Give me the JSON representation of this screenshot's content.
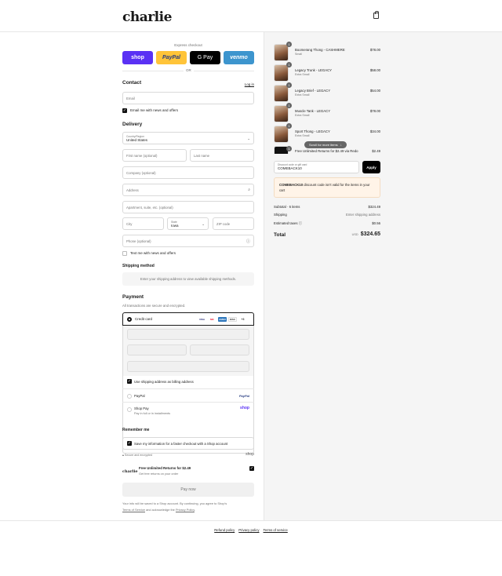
{
  "header": {
    "logo": "charlie"
  },
  "express": {
    "label": "Express checkout",
    "buttons": {
      "shop_pay": "shop",
      "paypal": "PayPal",
      "gpay": "G Pay",
      "venmo": "venmo"
    },
    "or": "OR"
  },
  "contact": {
    "title": "Contact",
    "login": "Log in",
    "email_placeholder": "Email",
    "email_news": "Email me with news and offers"
  },
  "delivery": {
    "title": "Delivery",
    "country_label": "Country/Region",
    "country_value": "United States",
    "first_name": "First name (optional)",
    "last_name": "Last name",
    "company": "Company (optional)",
    "address": "Address",
    "apartment": "Apartment, suite, etc. (optional)",
    "city": "City",
    "state_label": "State",
    "state_value": "Iowa",
    "zip": "ZIP code",
    "phone": "Phone (optional)",
    "text_news": "Text me with news and offers"
  },
  "shipping": {
    "title": "Shipping method",
    "notice": "Enter your shipping address to view available shipping methods."
  },
  "payment": {
    "title": "Payment",
    "subtitle": "All transactions are secure and encrypted.",
    "credit_card": "Credit card",
    "card_logos": [
      "VISA",
      "MC",
      "AMEX",
      "DISC"
    ],
    "more_cards": "+3",
    "billing_same": "Use shipping address as billing address",
    "paypal_label": "PayPal",
    "paypal_logo": "PayPal",
    "shop_pay_label": "Shop Pay",
    "shop_pay_sub": "Pay in full or in installments",
    "shop_pay_logo": "shop"
  },
  "remember": {
    "title": "Remember me",
    "save_info": "Save my information for a faster checkout with a Shop account",
    "secure": "Secure and encrypted",
    "shop_logo": "shop"
  },
  "returns_offer": {
    "logo": "charlie",
    "title": "Free Unlimited Returns for $2.49",
    "sub": "Get free returns on your order"
  },
  "pay_now": "Pay now",
  "legal": {
    "text1": "Your info will be saved to a Shop account. By continuing, you agree to Shop's",
    "terms": "Terms of Service",
    "and": "and acknowledge the",
    "privacy": "Privacy Policy",
    "period": "."
  },
  "order": {
    "items": [
      {
        "name": "Boomerang Thong - CASHMERE",
        "variant": "Small",
        "price": "$78.00",
        "qty": "1"
      },
      {
        "name": "Legacy Trunk - LEGACY",
        "variant": "Extra Small",
        "price": "$58.00",
        "qty": "1"
      },
      {
        "name": "Legacy Brief - LEGACY",
        "variant": "Extra Small",
        "price": "$54.00",
        "qty": "1"
      },
      {
        "name": "Muscle Tank - LEGACY",
        "variant": "Extra Small",
        "price": "$78.00",
        "qty": "1"
      },
      {
        "name": "Sport Thong - LEGACY",
        "variant": "Extra Small",
        "price": "$34.00",
        "qty": "1"
      },
      {
        "name": "Free Unlimited Returns for $2.49 via Redo",
        "variant": "",
        "price": "$2.49",
        "qty": "1"
      }
    ],
    "scroll_hint": "Scroll for more items",
    "discount_label": "Discount code or gift card",
    "discount_value": "COMEBACK10",
    "apply": "Apply",
    "error_code": "COMEBACK10",
    "error_text": "discount code isn't valid for the items in your cart",
    "subtotal_label": "Subtotal · 6 items",
    "subtotal_value": "$324.49",
    "shipping_label": "Shipping",
    "shipping_value": "Enter shipping address",
    "taxes_label": "Estimated taxes",
    "taxes_value": "$0.56",
    "total_label": "Total",
    "total_currency": "USD",
    "total_value": "$324.65"
  },
  "footer": {
    "refund": "Refund policy",
    "privacy": "Privacy policy",
    "terms": "Terms of service"
  }
}
